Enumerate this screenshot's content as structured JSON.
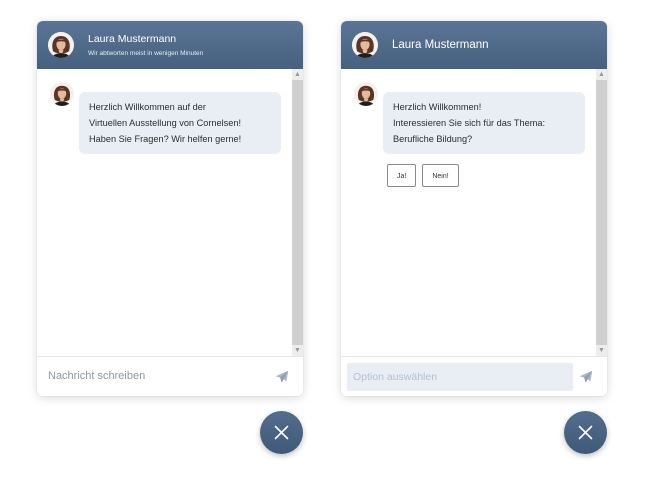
{
  "colors": {
    "header": "#4f6a8a",
    "bubble": "#e9eef5",
    "close_button": "#4a6584",
    "placeholder": "#8c98a6"
  },
  "left_chat": {
    "agent_name": "Laura Mustermann",
    "agent_status": "Wir abtworten meist in wenigen Minuten",
    "message_lines": [
      "Herzlich Willkommen auf der",
      "Virtuellen Ausstellung von Cornelsen!",
      "Haben Sie Fragen? Wir helfen gerne!"
    ],
    "input_placeholder": "Nachricht schreiben",
    "send_icon": "paper-plane-icon",
    "close_icon": "close-icon"
  },
  "right_chat": {
    "agent_name": "Laura Mustermann",
    "message_lines": [
      "Herzlich Willkommen!",
      "Interessieren Sie sich für das Thema:",
      "Berufliche Bildung?"
    ],
    "options": [
      "Ja!",
      "Nein!"
    ],
    "input_placeholder": "Option auswählen",
    "send_icon": "paper-plane-icon",
    "close_icon": "close-icon"
  }
}
